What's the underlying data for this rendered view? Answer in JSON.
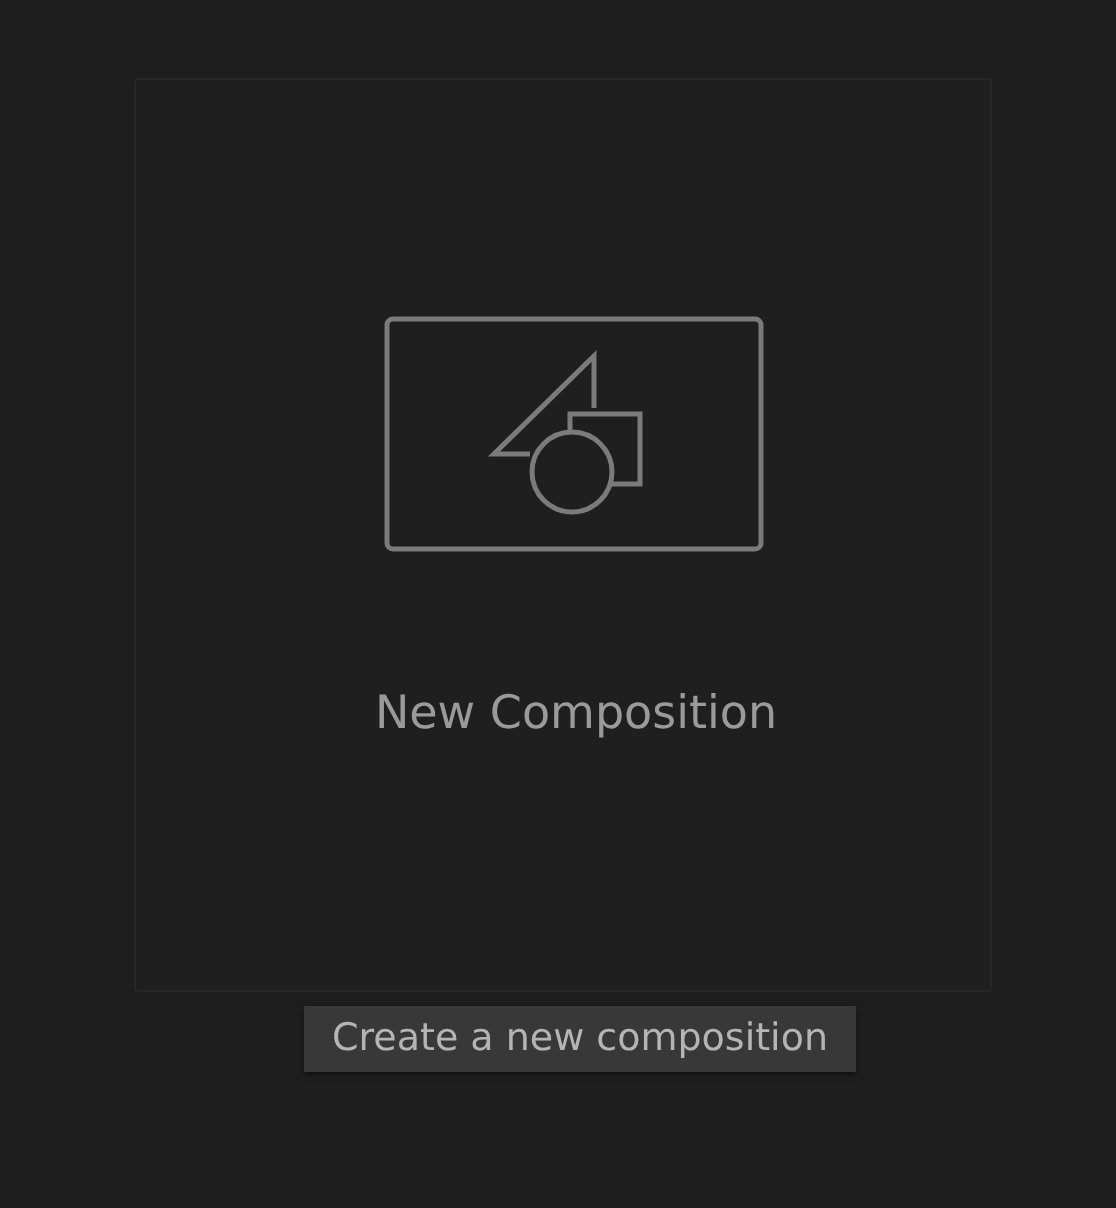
{
  "card": {
    "title": "New Composition"
  },
  "tooltip": {
    "text": "Create a new composition"
  }
}
